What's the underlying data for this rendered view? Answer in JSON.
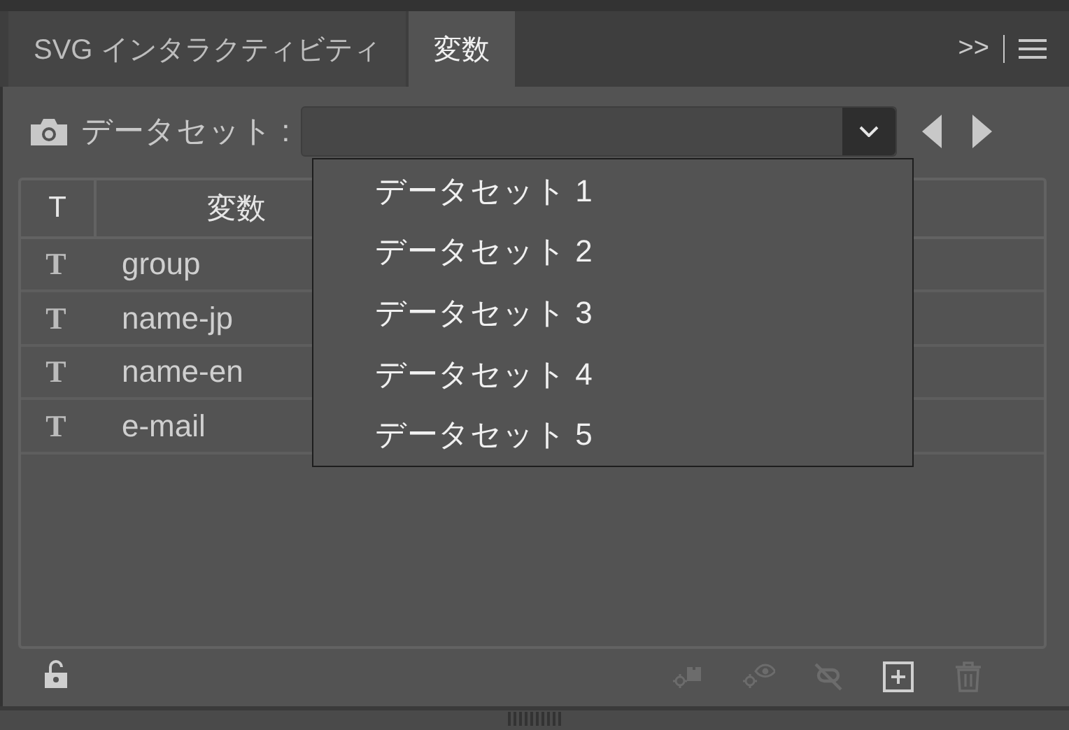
{
  "tabs": [
    {
      "label": "SVG インタラクティビティ",
      "selected": false
    },
    {
      "label": "変数",
      "selected": true
    }
  ],
  "panel_menu": {
    "overflow": ">>"
  },
  "dataset": {
    "label": "データセット :"
  },
  "table": {
    "columns": [
      "T",
      "変数"
    ],
    "rows": [
      {
        "type": "T",
        "name": "group"
      },
      {
        "type": "T",
        "name": "name-jp"
      },
      {
        "type": "T",
        "name": "name-en"
      },
      {
        "type": "T",
        "name": "e-mail"
      }
    ]
  },
  "dropdown": {
    "items": [
      "データセット 1",
      "データセット 2",
      "データセット 3",
      "データセット 4",
      "データセット 5"
    ]
  },
  "toolbar": [
    {
      "kind": "lock",
      "disabled": false
    },
    {
      "kind": "make-object",
      "disabled": true
    },
    {
      "kind": "make-visibility",
      "disabled": true
    },
    {
      "kind": "unbind",
      "disabled": true
    },
    {
      "kind": "new",
      "disabled": false
    },
    {
      "kind": "delete",
      "disabled": true
    }
  ]
}
